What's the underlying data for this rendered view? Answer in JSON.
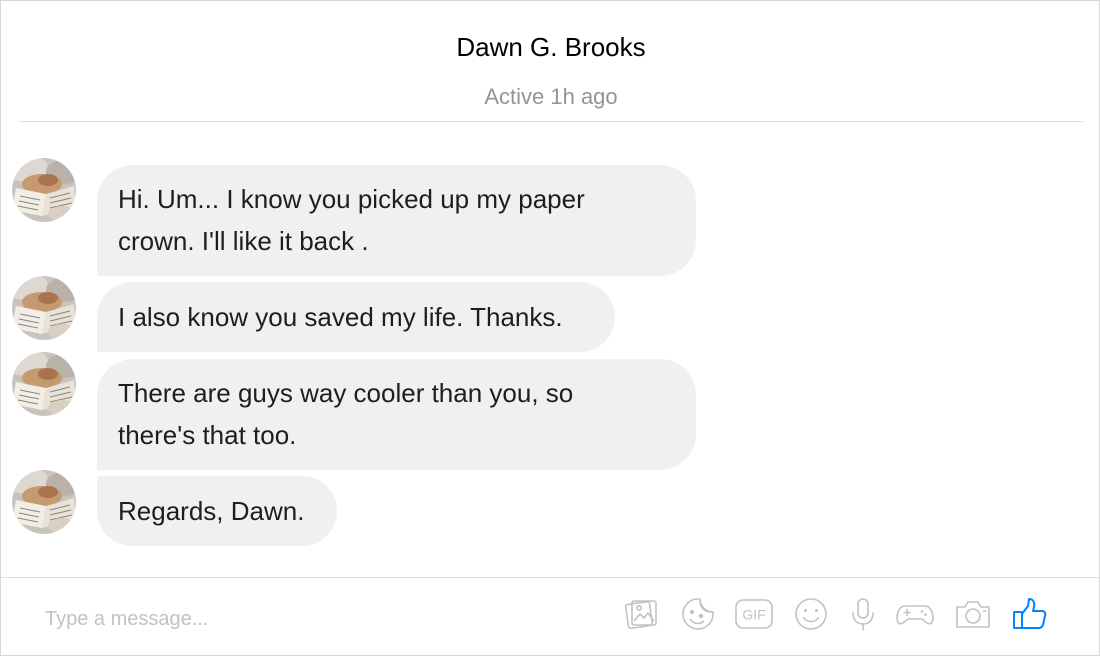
{
  "conversation": {
    "contact_name": "Dawn G. Brooks",
    "presence": "Active 1h ago"
  },
  "messages": [
    {
      "sender": "Dawn G. Brooks",
      "lines": [
        "Hi. Um... I know you picked up my paper",
        "crown. I'll like it back ."
      ]
    },
    {
      "sender": "Dawn G. Brooks",
      "lines": [
        "I also know you saved my life. Thanks."
      ]
    },
    {
      "sender": "Dawn G. Brooks",
      "lines": [
        "There are guys way cooler than you, so",
        "there's that too."
      ]
    },
    {
      "sender": "Dawn G. Brooks",
      "lines": [
        "Regards, Dawn."
      ]
    }
  ],
  "composer": {
    "placeholder": "Type a message...",
    "tools": [
      "photo-icon",
      "sticker-icon",
      "gif-icon",
      "emoji-icon",
      "microphone-icon",
      "game-controller-icon",
      "camera-icon",
      "thumbs-up-icon"
    ],
    "gif_label": "GIF"
  },
  "colors": {
    "bubble_background": "#f1f0f0",
    "icon_gray": "#bec3c9",
    "like_blue": "#0084ff",
    "presence_gray": "#90949c"
  }
}
